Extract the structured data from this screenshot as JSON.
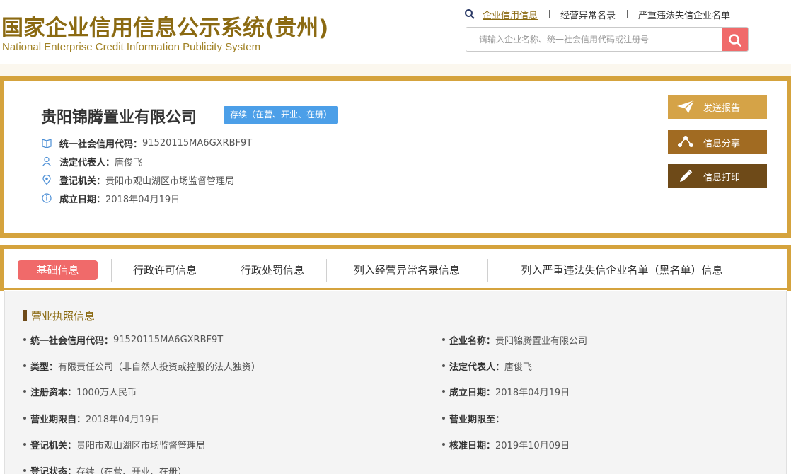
{
  "header": {
    "logo_cn": "国家企业信用信息公示系统(贵州)",
    "logo_en": "National Enterprise Credit Information Publicity System",
    "nav": [
      "企业信用信息",
      "经营异常名录",
      "严重违法失信企业名单"
    ],
    "search_placeholder": "请输入企业名称、统一社会信用代码或注册号"
  },
  "company": {
    "name": "贵阳锦腾置业有限公司",
    "status": "存续（在营、开业、在册）",
    "credit_code_label": "统一社会信用代码：",
    "credit_code": "91520115MA6GXRBF9T",
    "legal_rep_label": "法定代表人：",
    "legal_rep": "唐俊飞",
    "authority_label": "登记机关：",
    "authority": "贵阳市观山湖区市场监督管理局",
    "founded_label": "成立日期：",
    "founded": "2018年04月19日"
  },
  "actions": {
    "send": "发送报告",
    "share": "信息分享",
    "print": "信息打印"
  },
  "tabs": [
    "基础信息",
    "行政许可信息",
    "行政处罚信息",
    "列入经营异常名录信息",
    "列入严重违法失信企业名单（黑名单）信息"
  ],
  "license": {
    "title": "营业执照信息",
    "fields": [
      {
        "label": "统一社会信用代码：",
        "value": "91520115MA6GXRBF9T"
      },
      {
        "label": "企业名称：",
        "value": "贵阳锦腾置业有限公司"
      },
      {
        "label": "类型：",
        "value": "有限责任公司（非自然人投资或控股的法人独资）"
      },
      {
        "label": "法定代表人：",
        "value": "唐俊飞"
      },
      {
        "label": "注册资本：",
        "value": "1000万人民币"
      },
      {
        "label": "成立日期：",
        "value": "2018年04月19日"
      },
      {
        "label": "营业期限自：",
        "value": "2018年04月19日"
      },
      {
        "label": "营业期限至：",
        "value": ""
      },
      {
        "label": "登记机关：",
        "value": "贵阳市观山湖区市场监督管理局"
      },
      {
        "label": "核准日期：",
        "value": "2019年10月09日"
      },
      {
        "label": "登记状态：",
        "value": "存续（在营、开业、在册）"
      }
    ]
  }
}
